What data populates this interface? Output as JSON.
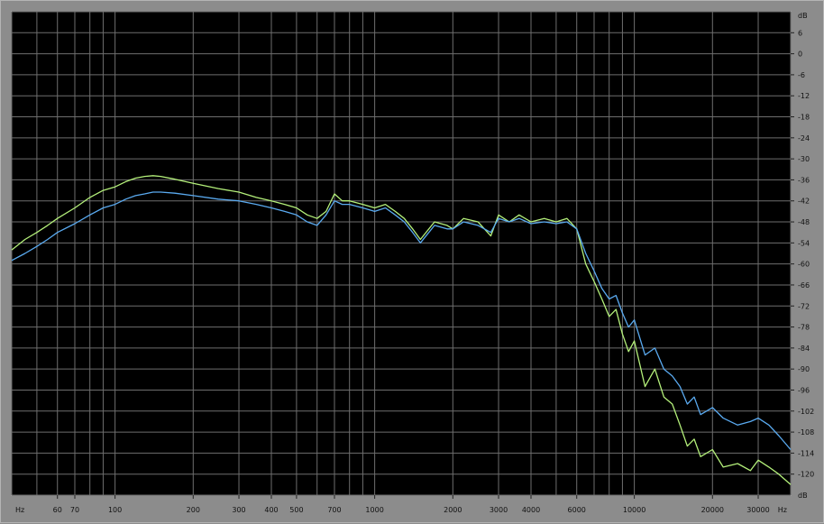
{
  "chart_data": {
    "type": "line",
    "title": "",
    "xlabel": "Hz",
    "ylabel": "dB",
    "x_scale": "log",
    "xlim": [
      40,
      40000
    ],
    "ylim": [
      -126,
      12
    ],
    "grid": true,
    "x_ticks": [
      {
        "value": 60,
        "label": "60"
      },
      {
        "value": 70,
        "label": "70"
      },
      {
        "value": 100,
        "label": "100"
      },
      {
        "value": 200,
        "label": "200"
      },
      {
        "value": 300,
        "label": "300"
      },
      {
        "value": 400,
        "label": "400"
      },
      {
        "value": 500,
        "label": "500"
      },
      {
        "value": 700,
        "label": "700"
      },
      {
        "value": 1000,
        "label": "1000"
      },
      {
        "value": 2000,
        "label": "2000"
      },
      {
        "value": 3000,
        "label": "3000"
      },
      {
        "value": 4000,
        "label": "4000"
      },
      {
        "value": 6000,
        "label": "6000"
      },
      {
        "value": 10000,
        "label": "10000"
      },
      {
        "value": 20000,
        "label": "20000"
      },
      {
        "value": 30000,
        "label": "30000"
      }
    ],
    "x_unit_label": "Hz",
    "y_ticks": [
      6,
      0,
      -6,
      -12,
      -18,
      -24,
      -30,
      -36,
      -42,
      -48,
      -54,
      -60,
      -66,
      -72,
      -78,
      -84,
      -90,
      -96,
      -102,
      -108,
      -114,
      -120
    ],
    "y_unit_label": "dB",
    "colors": {
      "background": "#000000",
      "grid": "#6e6e6e",
      "frame": "#8c8c8c",
      "series_green": "#b4f07a",
      "series_blue": "#5aaaf0"
    },
    "series": [
      {
        "color": "#b4f07a",
        "x": [
          40,
          45,
          50,
          55,
          60,
          70,
          80,
          90,
          100,
          110,
          120,
          130,
          140,
          150,
          170,
          200,
          250,
          300,
          350,
          400,
          450,
          500,
          550,
          600,
          650,
          700,
          750,
          800,
          900,
          1000,
          1100,
          1200,
          1300,
          1400,
          1500,
          1700,
          1900,
          2000,
          2200,
          2500,
          2800,
          3000,
          3300,
          3600,
          4000,
          4500,
          5000,
          5500,
          6000,
          6500,
          7000,
          7500,
          8000,
          8500,
          9000,
          9500,
          10000,
          11000,
          12000,
          13000,
          14000,
          15000,
          16000,
          17000,
          18000,
          20000,
          22000,
          25000,
          28000,
          30000,
          33000,
          36000,
          40000
        ],
        "y": [
          -56,
          -53,
          -51,
          -49,
          -47,
          -44,
          -41,
          -39,
          -38,
          -36.5,
          -35.5,
          -35,
          -34.8,
          -35,
          -35.8,
          -37,
          -38.5,
          -39.5,
          -41,
          -42,
          -43,
          -44,
          -46,
          -47,
          -45,
          -40,
          -42,
          -42,
          -43,
          -44,
          -43,
          -45,
          -47,
          -50,
          -53,
          -48,
          -49,
          -50,
          -47,
          -48,
          -52,
          -46,
          -48,
          -46,
          -48,
          -47,
          -48,
          -47,
          -50,
          -60,
          -65,
          -70,
          -75,
          -73,
          -80,
          -85,
          -82,
          -95,
          -90,
          -98,
          -100,
          -106,
          -112,
          -110,
          -115,
          -113,
          -118,
          -117,
          -119,
          -116,
          -118,
          -120,
          -123
        ]
      },
      {
        "color": "#5aaaf0",
        "x": [
          40,
          45,
          50,
          55,
          60,
          70,
          80,
          90,
          100,
          110,
          120,
          130,
          140,
          150,
          170,
          200,
          250,
          300,
          350,
          400,
          450,
          500,
          550,
          600,
          650,
          700,
          750,
          800,
          900,
          1000,
          1100,
          1200,
          1300,
          1400,
          1500,
          1700,
          1900,
          2000,
          2200,
          2500,
          2800,
          3000,
          3300,
          3600,
          4000,
          4500,
          5000,
          5500,
          6000,
          6500,
          7000,
          7500,
          8000,
          8500,
          9000,
          9500,
          10000,
          11000,
          12000,
          13000,
          14000,
          15000,
          16000,
          17000,
          18000,
          20000,
          22000,
          25000,
          28000,
          30000,
          33000,
          36000,
          40000
        ],
        "y": [
          -59,
          -57,
          -55,
          -53,
          -51,
          -48.5,
          -46,
          -44,
          -43,
          -41.5,
          -40.5,
          -40,
          -39.5,
          -39.5,
          -39.8,
          -40.5,
          -41.5,
          -42,
          -43,
          -44,
          -45,
          -46,
          -48,
          -49,
          -46,
          -42,
          -43,
          -43,
          -44,
          -45,
          -44,
          -46,
          -48,
          -51,
          -54,
          -49,
          -50,
          -50,
          -48,
          -49,
          -51,
          -47,
          -48,
          -47,
          -48.5,
          -48,
          -48.5,
          -48,
          -50,
          -57,
          -62,
          -67,
          -70,
          -69,
          -74,
          -78,
          -76,
          -86,
          -84,
          -90,
          -92,
          -95,
          -100,
          -98,
          -103,
          -101,
          -104,
          -106,
          -105,
          -104,
          -106,
          -109,
          -113
        ]
      }
    ]
  }
}
